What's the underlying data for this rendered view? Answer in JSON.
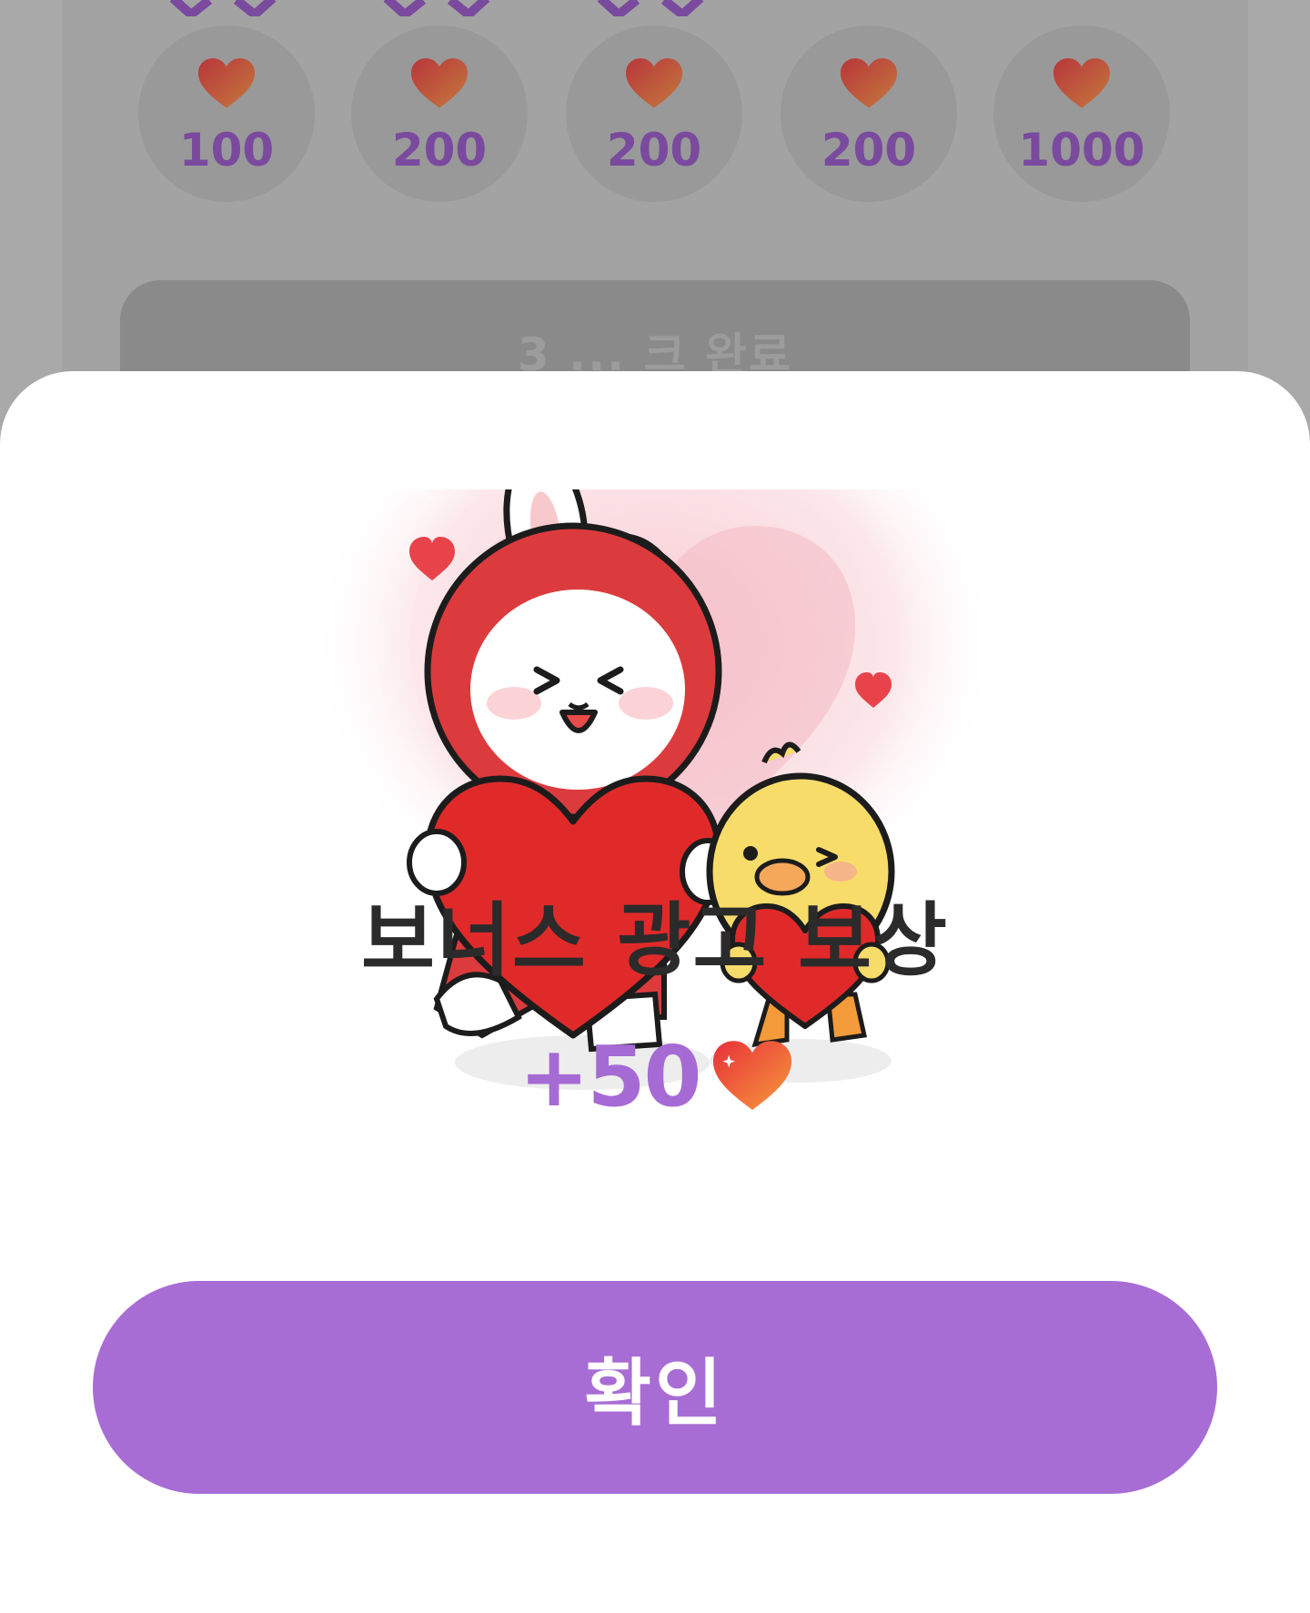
{
  "background": {
    "rewards": [
      {
        "value": "100"
      },
      {
        "value": "200"
      },
      {
        "value": "200"
      },
      {
        "value": "200"
      },
      {
        "value": "1000"
      }
    ],
    "bar_text": "3 ... 크 완료"
  },
  "sheet": {
    "title": "보너스 광고 보상",
    "reward_amount": "+50",
    "confirm_label": "확인"
  },
  "colors": {
    "accent": "#a86dd5",
    "heart": "#e94b3c",
    "title": "#2b2b2b"
  },
  "icons": {
    "heart": "heart-icon",
    "illustration": "bunny-and-chick-holding-hearts"
  }
}
